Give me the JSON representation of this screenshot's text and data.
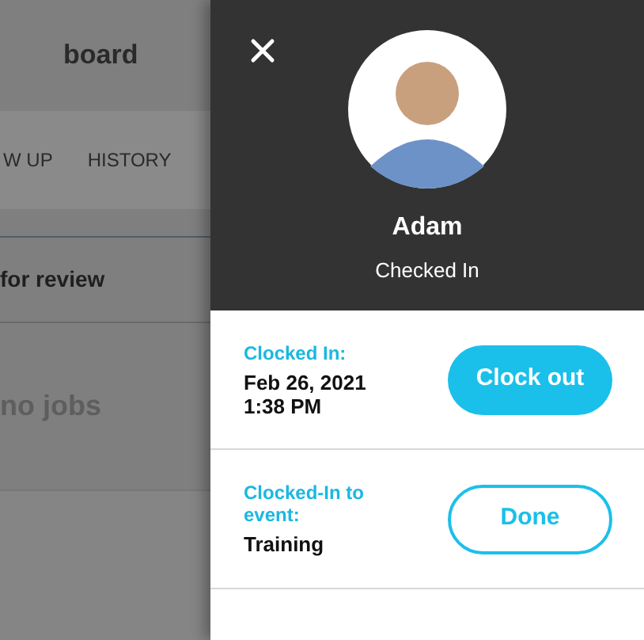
{
  "background_page": {
    "title": "board",
    "tabs": [
      {
        "label": "W UP",
        "selected": false
      },
      {
        "label": "HISTORY",
        "selected": false
      }
    ],
    "section_heading": "for review",
    "empty_message": "no jobs"
  },
  "panel": {
    "name": "Adam",
    "status": "Checked In",
    "rows": [
      {
        "label": "Clocked In:",
        "lines": [
          "Feb 26, 2021",
          "1:38 PM"
        ],
        "button": {
          "label": "Clock out",
          "kind": "filled"
        }
      },
      {
        "label": "Clocked-In to event:",
        "lines": [
          "Training"
        ],
        "button": {
          "label": "Done",
          "kind": "outline"
        }
      }
    ]
  }
}
